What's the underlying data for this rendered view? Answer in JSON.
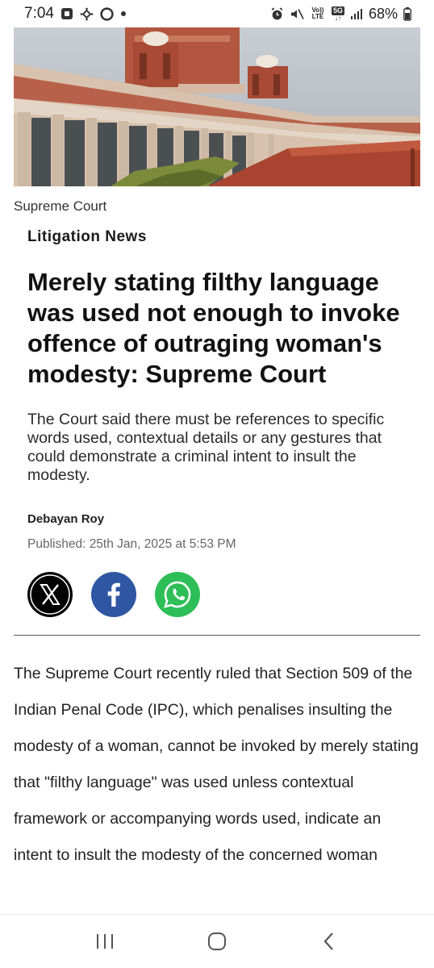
{
  "status_bar": {
    "time": "7:04",
    "volte_label": "Vo)) LTE",
    "network": "5G",
    "battery": "68%"
  },
  "hero": {
    "caption": "Supreme Court"
  },
  "article": {
    "category": "Litigation News",
    "headline": "Merely stating filthy language was used not enough to invoke offence of outraging woman's modesty: Supreme Court",
    "summary": "The Court said there must be references to specific words used, contextual details or any gestures that could demonstrate a criminal intent to insult the modesty.",
    "author": "Debayan Roy",
    "published": "Published: 25th Jan, 2025 at 5:53 PM",
    "body": "The Supreme Court recently ruled that Section 509 of the Indian Penal Code (IPC), which penalises insulting the modesty of a woman, cannot be invoked by merely stating that \"filthy language\" was used unless contextual framework or accompanying words used, indicate an intent to insult the modesty of the concerned woman"
  },
  "share": {
    "icons": [
      "x-icon",
      "facebook-icon",
      "whatsapp-icon"
    ]
  },
  "colors": {
    "facebook": "#2f56a2",
    "whatsapp": "#2dbe57",
    "x": "#000000"
  },
  "nav_bar": {
    "icons": [
      "recent-apps-icon",
      "home-icon",
      "back-icon"
    ]
  }
}
